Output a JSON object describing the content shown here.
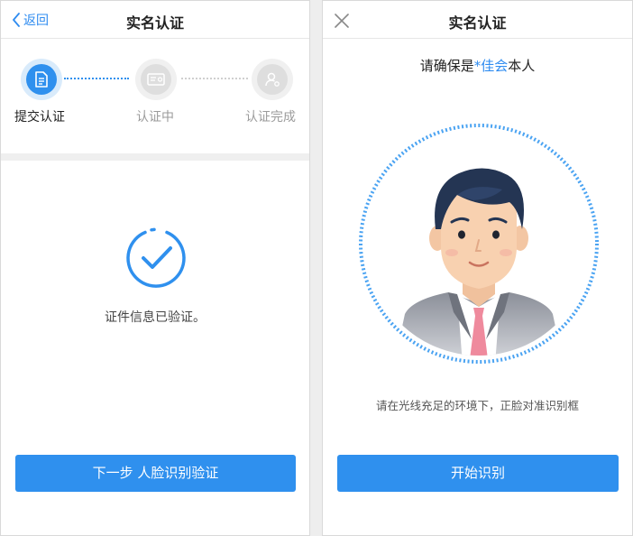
{
  "left": {
    "back_label": "返回",
    "title": "实名认证",
    "steps": [
      {
        "label": "提交认证",
        "state": "active"
      },
      {
        "label": "认证中",
        "state": "inactive"
      },
      {
        "label": "认证完成",
        "state": "inactive"
      }
    ],
    "verified_text": "证件信息已验证。",
    "next_button": "下一步 人脸识别验证"
  },
  "right": {
    "title": "实名认证",
    "confirm_prefix": "请确保是",
    "confirm_name": "*佳会",
    "confirm_suffix": "本人",
    "hint": "请在光线充足的环境下，正脸对准识别框",
    "start_button": "开始识别"
  },
  "colors": {
    "accent": "#2f90ee",
    "link": "#2f8cf0",
    "inactive": "#9b9b9b"
  },
  "icons": [
    "chevron-left-icon",
    "close-icon",
    "document-icon",
    "id-card-icon",
    "user-check-icon",
    "check-circle-icon"
  ]
}
